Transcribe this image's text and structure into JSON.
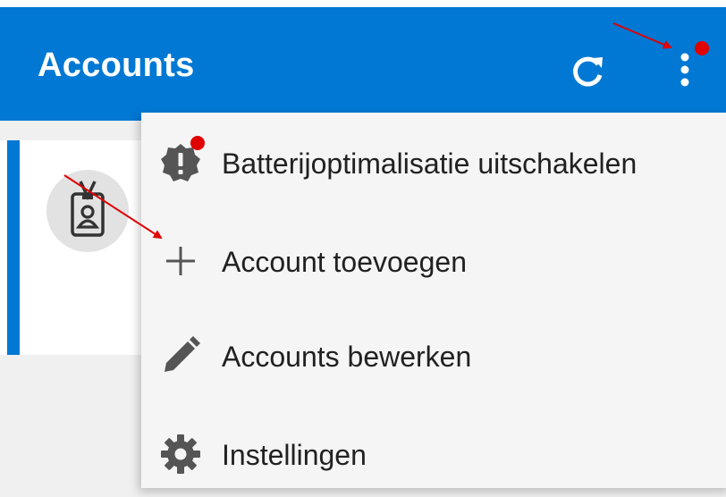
{
  "appbar": {
    "title": "Accounts",
    "refresh_icon": "refresh-icon",
    "more_icon": "more-vertical-icon",
    "color": "#0078d4"
  },
  "account_card": {
    "icon": "badge-icon",
    "accent_color": "#0078d4"
  },
  "menu": {
    "items": [
      {
        "label": "Batterijoptimalisatie uitschakelen",
        "icon": "warning-badge-icon"
      },
      {
        "label": "Account toevoegen",
        "icon": "plus-icon"
      },
      {
        "label": "Accounts bewerken",
        "icon": "pencil-icon"
      },
      {
        "label": "Instellingen",
        "icon": "gear-icon"
      }
    ]
  },
  "annotations": {
    "marker_color": "#e00000"
  }
}
